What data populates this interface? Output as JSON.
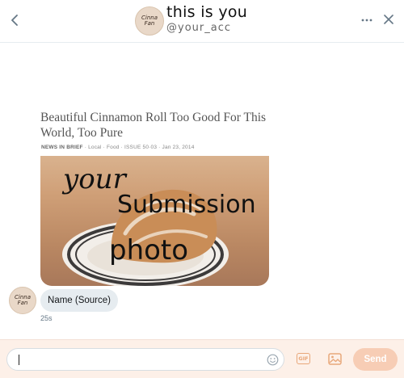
{
  "header": {
    "title": "this is you",
    "handle": "@your_acc",
    "avatar_text_1": "Cinna",
    "avatar_text_2": "Fan"
  },
  "card": {
    "headline": "Beautiful Cinnamon Roll Too Good For This World, Too Pure",
    "meta_prefix": "NEWS IN BRIEF",
    "meta_rest": " · Local · Food · ISSUE 50·03 · Jan 23, 2014",
    "overlay_line_1": "your",
    "overlay_line_2": "Submission",
    "overlay_line_3": "photo"
  },
  "message": {
    "avatar_text_1": "Cinna",
    "avatar_text_2": "Fan",
    "name": "Name (Source)",
    "time": "25s"
  },
  "composer": {
    "input_value": "",
    "gif_label": "GIF",
    "send_label": "Send"
  },
  "colors": {
    "accent": "#e8a77a",
    "send_disabled": "#f7cdb5",
    "composer_bg": "#fdf0e8",
    "bubble_bg": "#e6ecf0"
  },
  "icons": {
    "back": "chevron-left-icon",
    "more": "more-dots-icon",
    "close": "close-icon",
    "emoji": "emoji-icon",
    "gif": "gif-icon",
    "image": "image-icon"
  }
}
